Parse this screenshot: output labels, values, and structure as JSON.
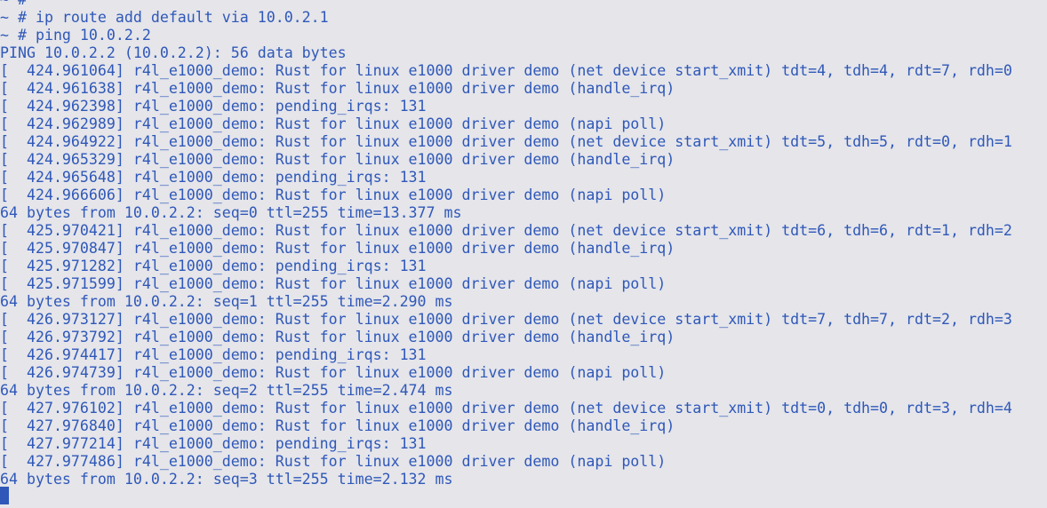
{
  "colors": {
    "background": "#e5e5ea",
    "text": "#2f58b8"
  },
  "terminal": {
    "lines": [
      "~ #",
      "~ # ip route add default via 10.0.2.1",
      "~ # ping 10.0.2.2",
      "PING 10.0.2.2 (10.0.2.2): 56 data bytes",
      "[  424.961064] r4l_e1000_demo: Rust for linux e1000 driver demo (net device start_xmit) tdt=4, tdh=4, rdt=7, rdh=0",
      "[  424.961638] r4l_e1000_demo: Rust for linux e1000 driver demo (handle_irq)",
      "[  424.962398] r4l_e1000_demo: pending_irqs: 131",
      "[  424.962989] r4l_e1000_demo: Rust for linux e1000 driver demo (napi poll)",
      "[  424.964922] r4l_e1000_demo: Rust for linux e1000 driver demo (net device start_xmit) tdt=5, tdh=5, rdt=0, rdh=1",
      "[  424.965329] r4l_e1000_demo: Rust for linux e1000 driver demo (handle_irq)",
      "[  424.965648] r4l_e1000_demo: pending_irqs: 131",
      "[  424.966606] r4l_e1000_demo: Rust for linux e1000 driver demo (napi poll)",
      "64 bytes from 10.0.2.2: seq=0 ttl=255 time=13.377 ms",
      "[  425.970421] r4l_e1000_demo: Rust for linux e1000 driver demo (net device start_xmit) tdt=6, tdh=6, rdt=1, rdh=2",
      "[  425.970847] r4l_e1000_demo: Rust for linux e1000 driver demo (handle_irq)",
      "[  425.971282] r4l_e1000_demo: pending_irqs: 131",
      "[  425.971599] r4l_e1000_demo: Rust for linux e1000 driver demo (napi poll)",
      "64 bytes from 10.0.2.2: seq=1 ttl=255 time=2.290 ms",
      "[  426.973127] r4l_e1000_demo: Rust for linux e1000 driver demo (net device start_xmit) tdt=7, tdh=7, rdt=2, rdh=3",
      "[  426.973792] r4l_e1000_demo: Rust for linux e1000 driver demo (handle_irq)",
      "[  426.974417] r4l_e1000_demo: pending_irqs: 131",
      "[  426.974739] r4l_e1000_demo: Rust for linux e1000 driver demo (napi poll)",
      "64 bytes from 10.0.2.2: seq=2 ttl=255 time=2.474 ms",
      "[  427.976102] r4l_e1000_demo: Rust for linux e1000 driver demo (net device start_xmit) tdt=0, tdh=0, rdt=3, rdh=4",
      "[  427.976840] r4l_e1000_demo: Rust for linux e1000 driver demo (handle_irq)",
      "[  427.977214] r4l_e1000_demo: pending_irqs: 131",
      "[  427.977486] r4l_e1000_demo: Rust for linux e1000 driver demo (napi poll)",
      "64 bytes from 10.0.2.2: seq=3 ttl=255 time=2.132 ms"
    ]
  }
}
